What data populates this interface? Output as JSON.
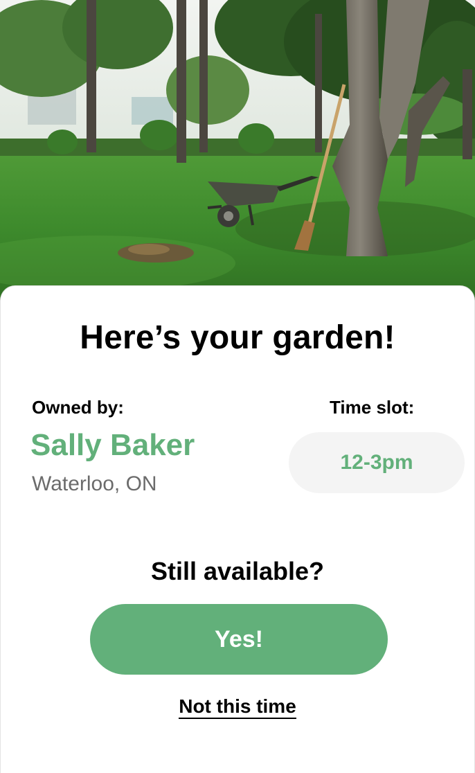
{
  "hero": {
    "image_name": "garden-photo",
    "colors": {
      "sky": "#e9efe9",
      "grass": "#3f8a2e",
      "trunk": "#6e6a5f"
    }
  },
  "card": {
    "title": "Here’s your garden!",
    "owner": {
      "label": "Owned by:",
      "name": "Sally Baker",
      "location": "Waterloo, ON"
    },
    "time_slot": {
      "label": "Time slot:",
      "value": "12-3pm"
    },
    "question": "Still available?",
    "confirm_label": "Yes!",
    "decline_label": "Not this time"
  },
  "colors": {
    "accent": "#62b07a",
    "pill_bg": "#f4f4f4",
    "muted_text": "#6b6b6b"
  }
}
